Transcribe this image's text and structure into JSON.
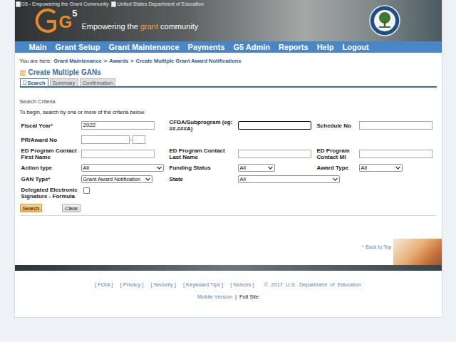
{
  "header": {
    "image_alts": [
      "G5 - Empowering the Grant Community",
      "United States Department of Education"
    ],
    "logo": {
      "letter": "G",
      "number": "5"
    },
    "tagline": [
      {
        "text": "Empowering the ",
        "accent": false
      },
      {
        "text": "grant",
        "accent": true
      },
      {
        "text": " community",
        "accent": false
      }
    ]
  },
  "nav": [
    "Main",
    "Grant Setup",
    "Grant Maintenance",
    "Payments",
    "G5 Admin",
    "Reports",
    "Help",
    "Logout"
  ],
  "breadcrumb": {
    "prefix": "You are here:",
    "separator": ">",
    "items": [
      "Grant Maintenance",
      "Awards",
      "Create Multiple Grant Award Notifications"
    ]
  },
  "page_title": "Create Multiple GANs",
  "tabs": [
    {
      "label": "Search",
      "selected": true
    },
    {
      "label": "Summary",
      "selected": false
    },
    {
      "label": "Confirmation",
      "selected": false
    }
  ],
  "section": {
    "title": "Search Criteria",
    "instruction": "To begin, search by one or more of the criteria below."
  },
  "form": {
    "rows": [
      [
        {
          "label": "Fiscal Year",
          "required": true,
          "kind": "text",
          "value": "2022",
          "focused": false
        },
        {
          "label": "CFDA/Subprogram (eg: ##.###A)",
          "required": false,
          "kind": "text",
          "value": "",
          "focused": true
        },
        {
          "label": "Schedule No",
          "required": false,
          "kind": "text",
          "value": "",
          "focused": false
        }
      ],
      [
        {
          "label": "PR/Award No",
          "required": false,
          "kind": "award",
          "value": "",
          "value2": "",
          "separator": "-"
        }
      ],
      [
        {
          "label": "ED Program Contact First Name",
          "required": false,
          "kind": "text",
          "value": "",
          "focused": false
        },
        {
          "label": "ED Program Contact Last Name",
          "required": false,
          "kind": "text",
          "value": "",
          "focused": false
        },
        {
          "label": "ED Program Contact MI",
          "required": false,
          "kind": "text",
          "value": "",
          "focused": false
        }
      ],
      [
        {
          "label": "Action type",
          "required": false,
          "kind": "select",
          "value": "All"
        },
        {
          "label": "Funding Status",
          "required": false,
          "kind": "select",
          "value": "All"
        },
        {
          "label": "Award Type",
          "required": false,
          "kind": "select",
          "value": "All"
        }
      ],
      [
        {
          "label": "GAN Type",
          "required": true,
          "kind": "select",
          "value": "Grant Award Notification"
        },
        {
          "label": "State",
          "required": false,
          "kind": "select",
          "value": "All"
        }
      ],
      [
        {
          "label": "Delegated Electronic Signature - Formula",
          "required": false,
          "kind": "checkbox",
          "checked": false
        }
      ]
    ],
    "required_mark": "*"
  },
  "buttons": [
    {
      "label": "Search",
      "primary": true
    },
    {
      "label": "Clear",
      "primary": false
    }
  ],
  "back_to_top": "^ Back to Top",
  "footer": {
    "open": "[",
    "close": "]",
    "links": [
      "FOIA",
      "Privacy",
      "Security",
      "Keyboard Tips",
      "Notices"
    ],
    "copyright": "©  2017  U.S.  Department  of  Education",
    "separator": "|",
    "site_links": [
      {
        "label": "Mobile Version",
        "selected": false
      },
      {
        "label": "Full Site",
        "selected": true
      }
    ]
  }
}
